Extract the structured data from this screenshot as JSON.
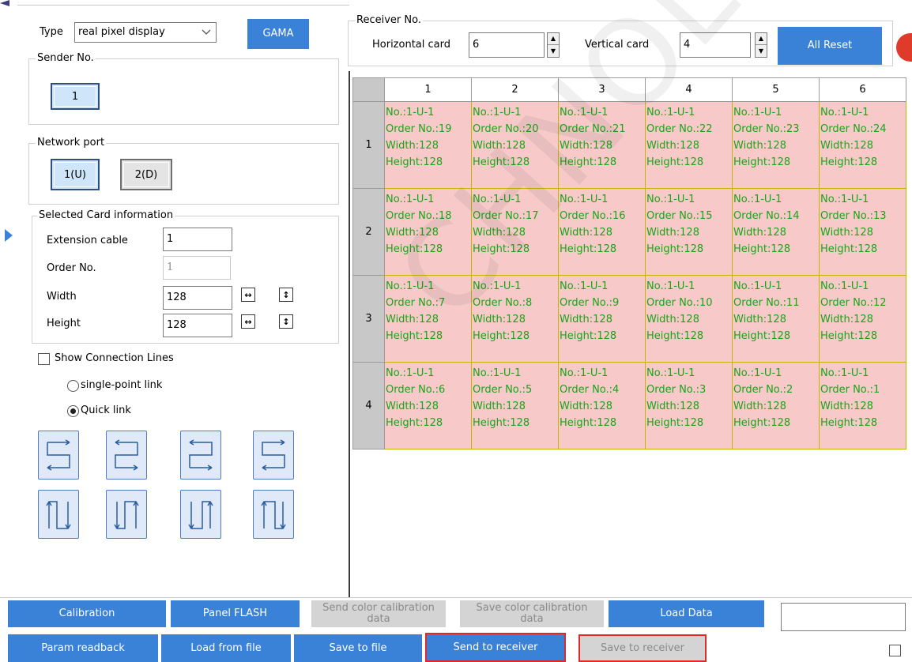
{
  "top": {
    "type_label": "Type",
    "type_value": "real pixel display",
    "gama_label": "GAMA"
  },
  "receiver": {
    "legend": "Receiver No.",
    "horizontal_label": "Horizontal card",
    "horizontal_value": "6",
    "vertical_label": "Vertical card",
    "vertical_value": "4",
    "all_reset_label": "All Reset"
  },
  "sender": {
    "legend": "Sender No.",
    "button_label": "1"
  },
  "network": {
    "legend": "Network port",
    "port1": "1(U)",
    "port2": "2(D)"
  },
  "card_info": {
    "legend": "Selected Card information",
    "extension_label": "Extension cable",
    "extension_value": "1",
    "order_label": "Order No.",
    "order_value": "1",
    "width_label": "Width",
    "width_value": "128",
    "height_label": "Height",
    "height_value": "128"
  },
  "connection": {
    "show_lines_label": "Show Connection Lines",
    "single_point_label": "single-point link",
    "quick_link_label": "Quick link"
  },
  "grid": {
    "columns": [
      "1",
      "2",
      "3",
      "4",
      "5",
      "6"
    ],
    "rows": [
      "1",
      "2",
      "3",
      "4"
    ],
    "cell_no": "No.:1-U-1",
    "cell_width": "Width:128",
    "cell_height": "Height:128",
    "orders": [
      [
        "Order No.:19",
        "Order No.:20",
        "Order No.:21",
        "Order No.:22",
        "Order No.:23",
        "Order No.:24"
      ],
      [
        "Order No.:18",
        "Order No.:17",
        "Order No.:16",
        "Order No.:15",
        "Order No.:14",
        "Order No.:13"
      ],
      [
        "Order No.:7",
        "Order No.:8",
        "Order No.:9",
        "Order No.:10",
        "Order No.:11",
        "Order No.:12"
      ],
      [
        "Order No.:6",
        "Order No.:5",
        "Order No.:4",
        "Order No.:3",
        "Order No.:2",
        "Order No.:1"
      ]
    ]
  },
  "bottom": {
    "calibration": "Calibration",
    "panel_flash": "Panel FLASH",
    "send_color_cal": "Send color calibration data",
    "save_color_cal": "Save color calibration data",
    "load_data": "Load Data",
    "param_readback": "Param readback",
    "load_from_file": "Load from file",
    "save_to_file": "Save to file",
    "send_to_receiver": "Send to receiver",
    "save_to_receiver": "Save to receiver"
  },
  "watermark": "CHNOLOGY",
  "colors": {
    "accent_blue": "#3a82d8",
    "cell_bg": "#f7c9c9",
    "cell_text": "#17a617",
    "highlight_red": "#e02a2a"
  }
}
